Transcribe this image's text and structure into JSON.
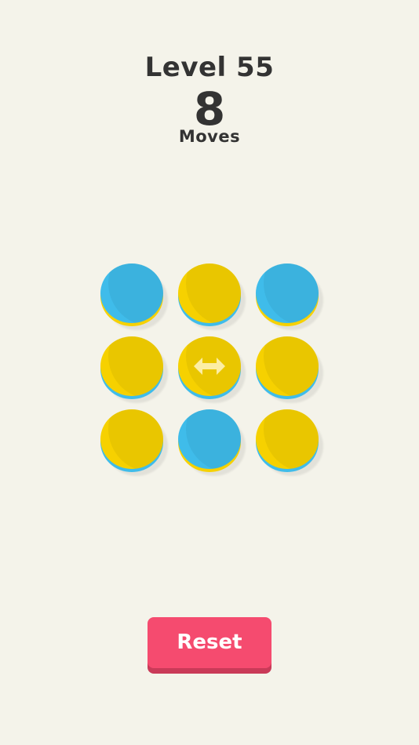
{
  "header": {
    "level_label": "Level 55",
    "move_count": "8",
    "moves_label": "Moves"
  },
  "colors": {
    "background": "#f4f3ea",
    "blue": "#3fbcea",
    "yellow": "#f6d100",
    "reset": "#f54b6f",
    "text": "#333333"
  },
  "grid": {
    "rows": 3,
    "cols": 3,
    "cells": [
      {
        "top": "blue",
        "under": "yellow",
        "icon": ""
      },
      {
        "top": "yellow",
        "under": "blue",
        "icon": ""
      },
      {
        "top": "blue",
        "under": "yellow",
        "icon": ""
      },
      {
        "top": "yellow",
        "under": "blue",
        "icon": ""
      },
      {
        "top": "yellow",
        "under": "blue",
        "icon": "left-right-arrow-icon"
      },
      {
        "top": "yellow",
        "under": "blue",
        "icon": ""
      },
      {
        "top": "yellow",
        "under": "blue",
        "icon": ""
      },
      {
        "top": "blue",
        "under": "yellow",
        "icon": ""
      },
      {
        "top": "yellow",
        "under": "blue",
        "icon": ""
      }
    ]
  },
  "reset_button": {
    "label": "Reset"
  }
}
